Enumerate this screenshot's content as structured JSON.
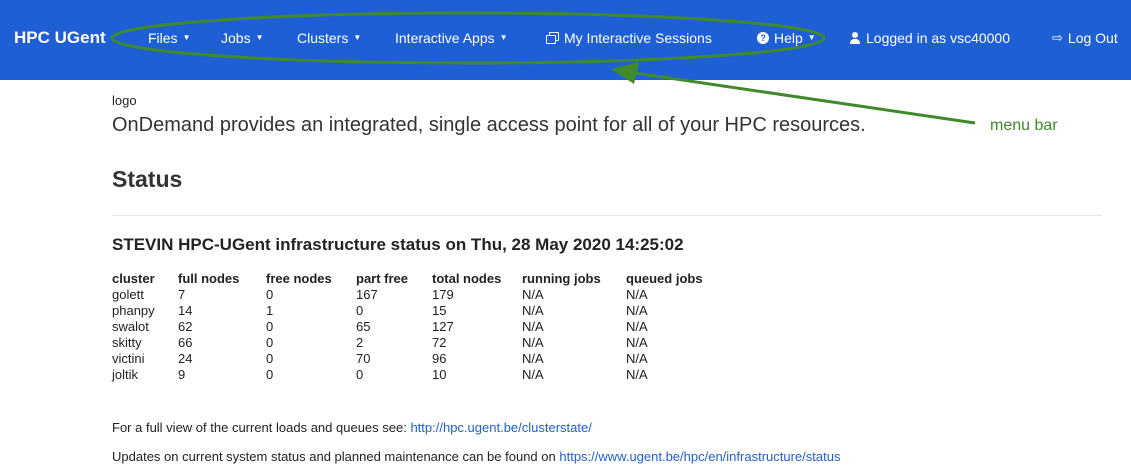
{
  "nav": {
    "brand": "HPC UGent",
    "files": "Files",
    "jobs": "Jobs",
    "clusters": "Clusters",
    "interactive_apps": "Interactive Apps",
    "my_sessions": "My Interactive Sessions",
    "help": "Help",
    "logged_in": "Logged in as vsc40000",
    "logout": "Log Out"
  },
  "annotation": {
    "label": "menu bar",
    "color": "#3f8a2a"
  },
  "main": {
    "logo_alt": "logo",
    "tagline": "OnDemand provides an integrated, single access point for all of your HPC resources.",
    "status_heading": "Status",
    "infra_heading": "STEVIN HPC-UGent infrastructure status on Thu, 28 May 2020 14:25:02",
    "table": {
      "headers": [
        "cluster",
        "full nodes",
        "free nodes",
        "part free",
        "total nodes",
        "running jobs",
        "queued jobs"
      ],
      "rows": [
        [
          "golett",
          "7",
          "0",
          "167",
          "179",
          "N/A",
          "N/A"
        ],
        [
          "phanpy",
          "14",
          "1",
          "0",
          "15",
          "N/A",
          "N/A"
        ],
        [
          "swalot",
          "62",
          "0",
          "65",
          "127",
          "N/A",
          "N/A"
        ],
        [
          "skitty",
          "66",
          "0",
          "2",
          "72",
          "N/A",
          "N/A"
        ],
        [
          "victini",
          "24",
          "0",
          "70",
          "96",
          "N/A",
          "N/A"
        ],
        [
          "joltik",
          "9",
          "0",
          "0",
          "10",
          "N/A",
          "N/A"
        ]
      ]
    },
    "loads_text": "For a full view of the current loads and queues see: ",
    "loads_link": "http://hpc.ugent.be/clusterstate/",
    "updates_text": "Updates on current system status and planned maintenance can be found on ",
    "updates_link": "https://www.ugent.be/hpc/en/infrastructure/status"
  },
  "colors": {
    "navbar": "#1f5fd6",
    "link": "#1f5fd6"
  }
}
